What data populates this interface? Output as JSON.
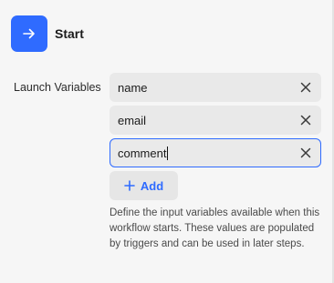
{
  "colors": {
    "accent": "#2f6bff",
    "background": "#f6f6f6",
    "field_background": "#e9e9e9"
  },
  "step": {
    "icon": "arrow-right-icon",
    "title": "Start"
  },
  "launch_variables": {
    "label": "Launch Variables",
    "items": [
      {
        "value": "name",
        "remove_icon": "close-icon"
      },
      {
        "value": "email",
        "remove_icon": "close-icon"
      },
      {
        "value": "comment",
        "remove_icon": "close-icon",
        "focused": true
      }
    ],
    "add_label": "Add",
    "add_icon": "plus-icon",
    "help_text": "Define the input variables available when this workflow starts. These values are populated by triggers and can be used in later steps."
  }
}
